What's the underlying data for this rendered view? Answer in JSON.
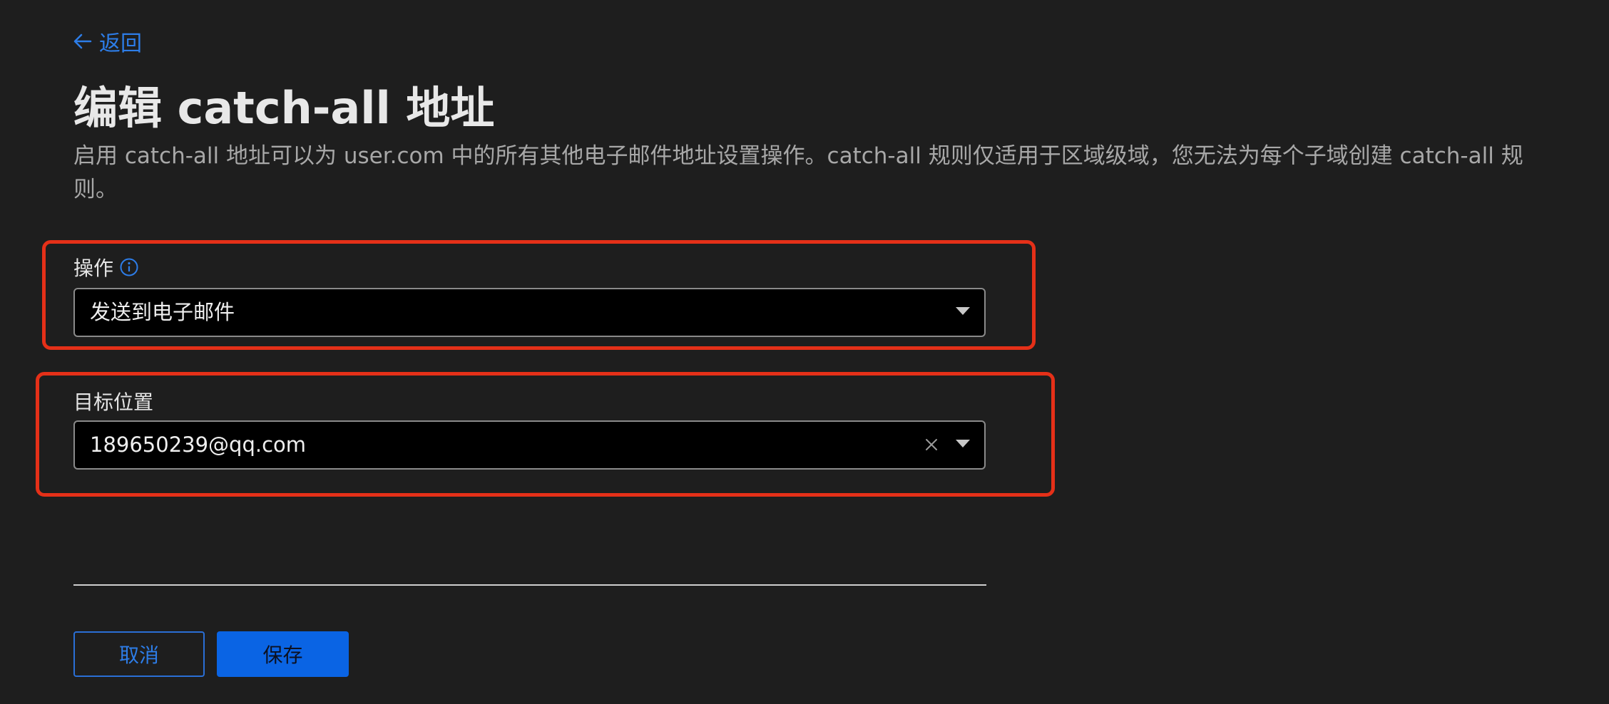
{
  "back": {
    "label": "返回"
  },
  "page": {
    "title": "编辑 catch-all 地址",
    "description": "启用 catch-all 地址可以为 user.com 中的所有其他电子邮件地址设置操作。catch-all 规则仅适用于区域级域，您无法为每个子域创建 catch-all 规则。"
  },
  "form": {
    "action": {
      "label": "操作",
      "value": "发送到电子邮件"
    },
    "destination": {
      "label": "目标位置",
      "value": "189650239@qq.com"
    }
  },
  "buttons": {
    "cancel": "取消",
    "save": "保存"
  },
  "colors": {
    "background": "#1e1e1e",
    "accent": "#2d7de8",
    "primary_button": "#0a64e4",
    "highlight_box": "#e53018"
  },
  "icons": {
    "back": "arrow-left-icon",
    "info": "info-circle-icon",
    "dropdown": "caret-down-icon",
    "clear": "close-icon"
  }
}
